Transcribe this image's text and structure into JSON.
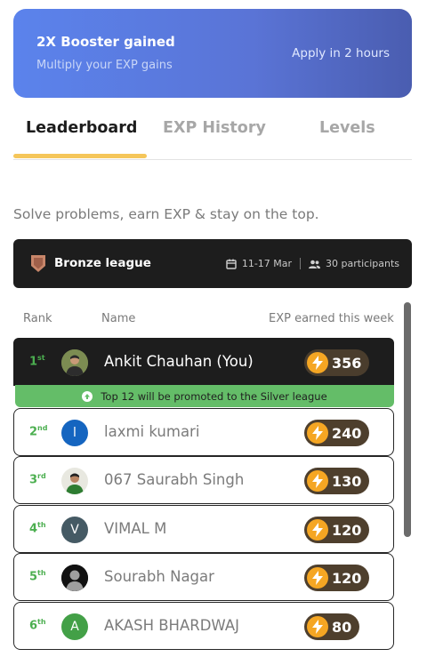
{
  "booster": {
    "title": "2X Booster gained",
    "subtitle": "Multiply your EXP gains",
    "apply": "Apply in 2 hours"
  },
  "tabs": [
    {
      "label": "Leaderboard",
      "active": true
    },
    {
      "label": "EXP History",
      "active": false
    },
    {
      "label": "Levels",
      "active": false
    }
  ],
  "tagline": "Solve problems, earn EXP & stay on the top.",
  "league": {
    "name": "Bronze league",
    "dates": "11-17 Mar",
    "participants": "30 participants",
    "icons": [
      "bronze-shield-icon",
      "calendar-icon",
      "people-icon"
    ]
  },
  "columns": {
    "rank": "Rank",
    "name": "Name",
    "exp": "EXP earned this week"
  },
  "promotion_text": "Top 12 will be promoted to the Silver league",
  "rows": [
    {
      "rank": "1",
      "suffix": "st",
      "name": "Ankit Chauhan (You)",
      "exp": "356",
      "avatar_type": "photo",
      "avatar_letter": "",
      "avatar_color": "#5b6b3a"
    },
    {
      "rank": "2",
      "suffix": "nd",
      "name": "laxmi kumari",
      "exp": "240",
      "avatar_type": "letter",
      "avatar_letter": "l",
      "avatar_color": "#1565c0"
    },
    {
      "rank": "3",
      "suffix": "rd",
      "name": "067 Saurabh Singh",
      "exp": "130",
      "avatar_type": "photo",
      "avatar_letter": "",
      "avatar_color": "#2e7d32"
    },
    {
      "rank": "4",
      "suffix": "th",
      "name": "VIMAL M",
      "exp": "120",
      "avatar_type": "letter",
      "avatar_letter": "V",
      "avatar_color": "#455a64"
    },
    {
      "rank": "5",
      "suffix": "th",
      "name": "Sourabh Nagar",
      "exp": "120",
      "avatar_type": "default",
      "avatar_letter": "",
      "avatar_color": "#1a1a1a"
    },
    {
      "rank": "6",
      "suffix": "th",
      "name": "AKASH BHARDWAJ",
      "exp": "80",
      "avatar_type": "letter",
      "avatar_letter": "A",
      "avatar_color": "#43a047"
    }
  ],
  "colors": {
    "accent_green": "#4caf50",
    "tab_underline": "#f5c65a",
    "booster_gradient_start": "#5b83ec",
    "booster_gradient_end": "#4a5db0",
    "exp_bolt": "#f5a623"
  }
}
